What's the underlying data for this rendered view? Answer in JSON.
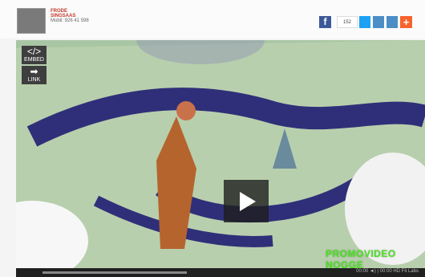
{
  "header": {
    "author_name_line1": "FRODE",
    "author_name_line2": "SINGSAAS",
    "author_phone": "Mobil: 926 41 598",
    "share_count": "152"
  },
  "video": {
    "embed_label": "EMBED",
    "link_label": "LINK",
    "watermark": "PROMOVIDEO NOGGE",
    "progress": 0.6,
    "controls_text": "00:00 ◄) | 00:00 HD  Fit Labs"
  },
  "colors": {
    "facebook": "#3b5998",
    "twitter": "#1da1f2",
    "mail": "#4a8ec5",
    "plus": "#f7622d",
    "watermark": "#49e11f"
  }
}
